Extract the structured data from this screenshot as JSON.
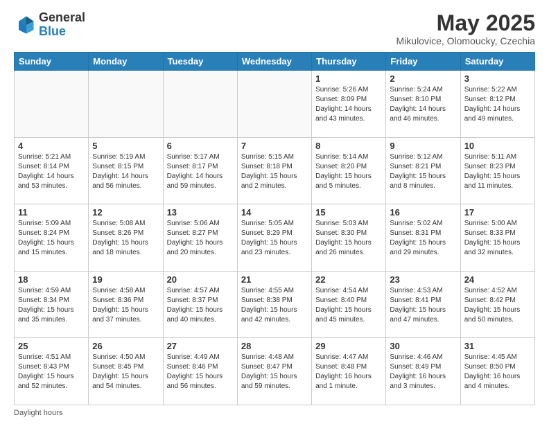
{
  "header": {
    "logo_line1": "General",
    "logo_line2": "Blue",
    "month_title": "May 2025",
    "subtitle": "Mikulovice, Olomoucky, Czechia"
  },
  "weekdays": [
    "Sunday",
    "Monday",
    "Tuesday",
    "Wednesday",
    "Thursday",
    "Friday",
    "Saturday"
  ],
  "weeks": [
    [
      {
        "day": "",
        "info": ""
      },
      {
        "day": "",
        "info": ""
      },
      {
        "day": "",
        "info": ""
      },
      {
        "day": "",
        "info": ""
      },
      {
        "day": "1",
        "info": "Sunrise: 5:26 AM\nSunset: 8:09 PM\nDaylight: 14 hours\nand 43 minutes."
      },
      {
        "day": "2",
        "info": "Sunrise: 5:24 AM\nSunset: 8:10 PM\nDaylight: 14 hours\nand 46 minutes."
      },
      {
        "day": "3",
        "info": "Sunrise: 5:22 AM\nSunset: 8:12 PM\nDaylight: 14 hours\nand 49 minutes."
      }
    ],
    [
      {
        "day": "4",
        "info": "Sunrise: 5:21 AM\nSunset: 8:14 PM\nDaylight: 14 hours\nand 53 minutes."
      },
      {
        "day": "5",
        "info": "Sunrise: 5:19 AM\nSunset: 8:15 PM\nDaylight: 14 hours\nand 56 minutes."
      },
      {
        "day": "6",
        "info": "Sunrise: 5:17 AM\nSunset: 8:17 PM\nDaylight: 14 hours\nand 59 minutes."
      },
      {
        "day": "7",
        "info": "Sunrise: 5:15 AM\nSunset: 8:18 PM\nDaylight: 15 hours\nand 2 minutes."
      },
      {
        "day": "8",
        "info": "Sunrise: 5:14 AM\nSunset: 8:20 PM\nDaylight: 15 hours\nand 5 minutes."
      },
      {
        "day": "9",
        "info": "Sunrise: 5:12 AM\nSunset: 8:21 PM\nDaylight: 15 hours\nand 8 minutes."
      },
      {
        "day": "10",
        "info": "Sunrise: 5:11 AM\nSunset: 8:23 PM\nDaylight: 15 hours\nand 11 minutes."
      }
    ],
    [
      {
        "day": "11",
        "info": "Sunrise: 5:09 AM\nSunset: 8:24 PM\nDaylight: 15 hours\nand 15 minutes."
      },
      {
        "day": "12",
        "info": "Sunrise: 5:08 AM\nSunset: 8:26 PM\nDaylight: 15 hours\nand 18 minutes."
      },
      {
        "day": "13",
        "info": "Sunrise: 5:06 AM\nSunset: 8:27 PM\nDaylight: 15 hours\nand 20 minutes."
      },
      {
        "day": "14",
        "info": "Sunrise: 5:05 AM\nSunset: 8:29 PM\nDaylight: 15 hours\nand 23 minutes."
      },
      {
        "day": "15",
        "info": "Sunrise: 5:03 AM\nSunset: 8:30 PM\nDaylight: 15 hours\nand 26 minutes."
      },
      {
        "day": "16",
        "info": "Sunrise: 5:02 AM\nSunset: 8:31 PM\nDaylight: 15 hours\nand 29 minutes."
      },
      {
        "day": "17",
        "info": "Sunrise: 5:00 AM\nSunset: 8:33 PM\nDaylight: 15 hours\nand 32 minutes."
      }
    ],
    [
      {
        "day": "18",
        "info": "Sunrise: 4:59 AM\nSunset: 8:34 PM\nDaylight: 15 hours\nand 35 minutes."
      },
      {
        "day": "19",
        "info": "Sunrise: 4:58 AM\nSunset: 8:36 PM\nDaylight: 15 hours\nand 37 minutes."
      },
      {
        "day": "20",
        "info": "Sunrise: 4:57 AM\nSunset: 8:37 PM\nDaylight: 15 hours\nand 40 minutes."
      },
      {
        "day": "21",
        "info": "Sunrise: 4:55 AM\nSunset: 8:38 PM\nDaylight: 15 hours\nand 42 minutes."
      },
      {
        "day": "22",
        "info": "Sunrise: 4:54 AM\nSunset: 8:40 PM\nDaylight: 15 hours\nand 45 minutes."
      },
      {
        "day": "23",
        "info": "Sunrise: 4:53 AM\nSunset: 8:41 PM\nDaylight: 15 hours\nand 47 minutes."
      },
      {
        "day": "24",
        "info": "Sunrise: 4:52 AM\nSunset: 8:42 PM\nDaylight: 15 hours\nand 50 minutes."
      }
    ],
    [
      {
        "day": "25",
        "info": "Sunrise: 4:51 AM\nSunset: 8:43 PM\nDaylight: 15 hours\nand 52 minutes."
      },
      {
        "day": "26",
        "info": "Sunrise: 4:50 AM\nSunset: 8:45 PM\nDaylight: 15 hours\nand 54 minutes."
      },
      {
        "day": "27",
        "info": "Sunrise: 4:49 AM\nSunset: 8:46 PM\nDaylight: 15 hours\nand 56 minutes."
      },
      {
        "day": "28",
        "info": "Sunrise: 4:48 AM\nSunset: 8:47 PM\nDaylight: 15 hours\nand 59 minutes."
      },
      {
        "day": "29",
        "info": "Sunrise: 4:47 AM\nSunset: 8:48 PM\nDaylight: 16 hours\nand 1 minute."
      },
      {
        "day": "30",
        "info": "Sunrise: 4:46 AM\nSunset: 8:49 PM\nDaylight: 16 hours\nand 3 minutes."
      },
      {
        "day": "31",
        "info": "Sunrise: 4:45 AM\nSunset: 8:50 PM\nDaylight: 16 hours\nand 4 minutes."
      }
    ]
  ],
  "footer": "Daylight hours"
}
